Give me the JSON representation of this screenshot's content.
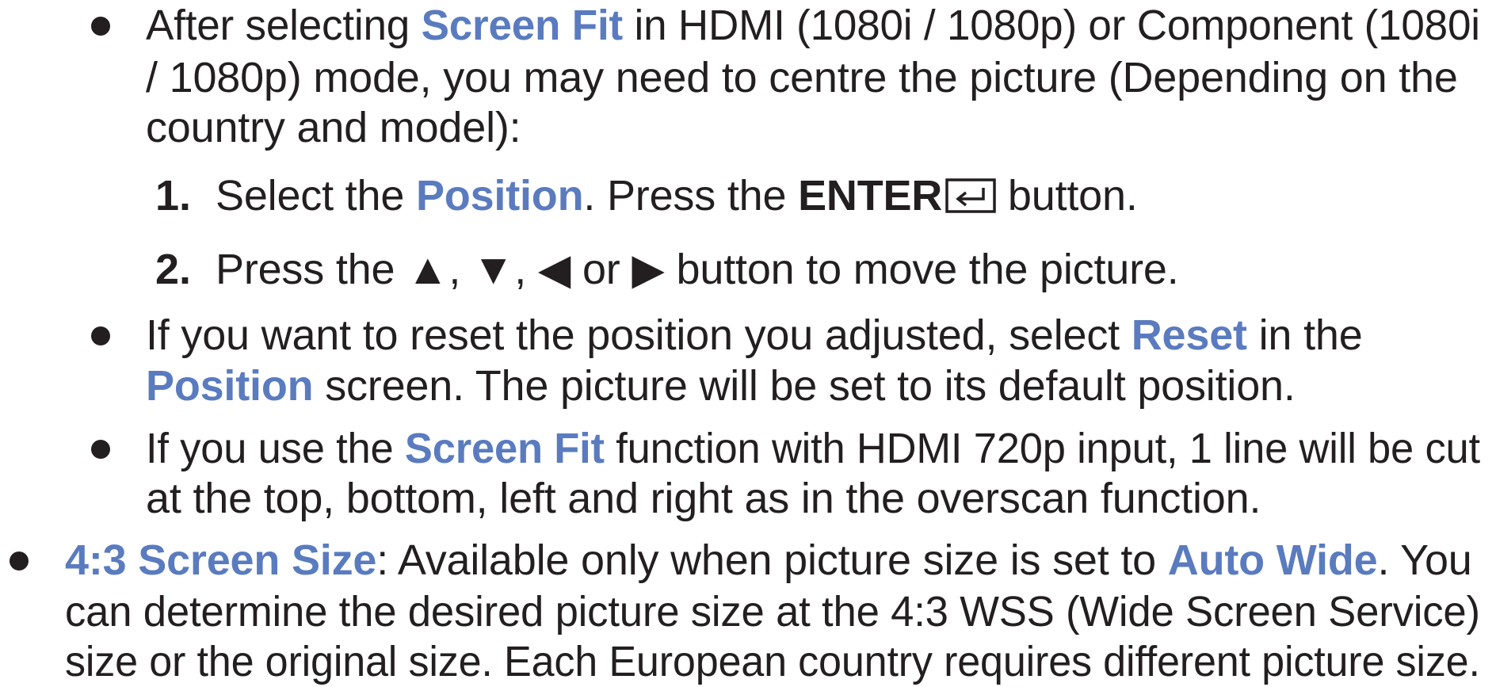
{
  "bullet1": {
    "line1_a": "After selecting ",
    "line1_b": "Screen Fit",
    "line1_c": " in HDMI (1080i / 1080p) or Component (1080i",
    "line2": "/ 1080p) mode, you may need to centre the picture (Depending on the",
    "line3": "country and model):"
  },
  "step1": {
    "num": "1.",
    "a": "Select the ",
    "b": "Position",
    "c": ". Press the ",
    "d": "ENTER",
    "e": " button."
  },
  "step2": {
    "num": "2.",
    "a": "Press the ",
    "up": "▲",
    "sep1": ", ",
    "down": "▼",
    "sep2": ", ",
    "left": "◀",
    "or": " or ",
    "right": "▶",
    "b": " button to move the picture."
  },
  "bullet2": {
    "line1_a": "If you want to reset the position you adjusted, select ",
    "line1_b": "Reset",
    "line1_c": " in the",
    "line2_a": "Position",
    "line2_b": " screen. The picture will be set to its default position."
  },
  "bullet3": {
    "line1_a": "If you use the ",
    "line1_b": "Screen Fit",
    "line1_c": " function with HDMI 720p input, 1 line will be cut",
    "line2": "at the top, bottom, left and right as in the overscan function."
  },
  "bullet4": {
    "line1_a": "4:3 Screen Size",
    "line1_b": ": Available only when picture size is set to ",
    "line1_c": "Auto Wide",
    "line1_d": ". You",
    "line2": "can determine the desired picture size at the 4:3 WSS (Wide Screen Service)",
    "line3": "size or the original size. Each European country requires different picture size."
  },
  "colors": {
    "text": "#231f20",
    "highlight": "#5a7bbf"
  },
  "icons": {
    "enter": "enter-icon"
  }
}
